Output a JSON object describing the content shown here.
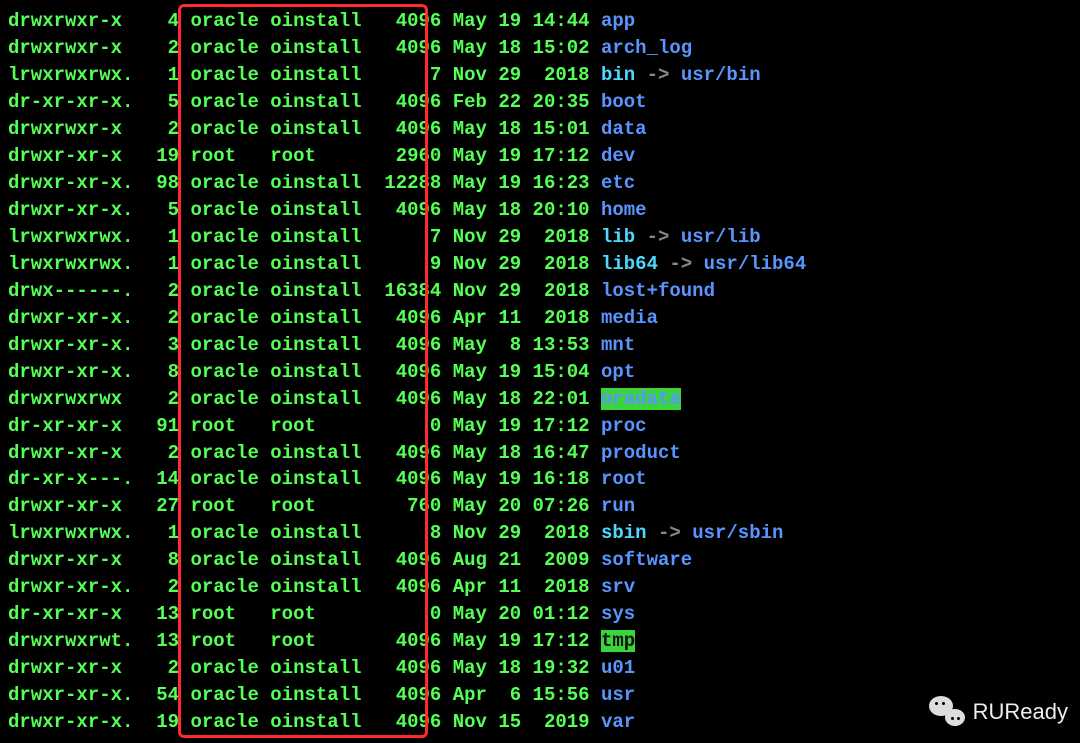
{
  "watermark": "RUReady",
  "entries": [
    {
      "perms": "drwxrwxr-x",
      "links": "4",
      "owner": "oracle",
      "group": "oinstall",
      "size": "4096",
      "date": "May 19 14:44",
      "name": "app",
      "type": "dir"
    },
    {
      "perms": "drwxrwxr-x",
      "links": "2",
      "owner": "oracle",
      "group": "oinstall",
      "size": "4096",
      "date": "May 18 15:02",
      "name": "arch_log",
      "type": "dir"
    },
    {
      "perms": "lrwxrwxrwx.",
      "links": "1",
      "owner": "oracle",
      "group": "oinstall",
      "size": "7",
      "date": "Nov 29  2018",
      "name": "bin",
      "type": "link",
      "target": "usr/bin"
    },
    {
      "perms": "dr-xr-xr-x.",
      "links": "5",
      "owner": "oracle",
      "group": "oinstall",
      "size": "4096",
      "date": "Feb 22 20:35",
      "name": "boot",
      "type": "dir"
    },
    {
      "perms": "drwxrwxr-x",
      "links": "2",
      "owner": "oracle",
      "group": "oinstall",
      "size": "4096",
      "date": "May 18 15:01",
      "name": "data",
      "type": "dir"
    },
    {
      "perms": "drwxr-xr-x",
      "links": "19",
      "owner": "root",
      "group": "root",
      "size": "2960",
      "date": "May 19 17:12",
      "name": "dev",
      "type": "dir"
    },
    {
      "perms": "drwxr-xr-x.",
      "links": "98",
      "owner": "oracle",
      "group": "oinstall",
      "size": "12288",
      "date": "May 19 16:23",
      "name": "etc",
      "type": "dir"
    },
    {
      "perms": "drwxr-xr-x.",
      "links": "5",
      "owner": "oracle",
      "group": "oinstall",
      "size": "4096",
      "date": "May 18 20:10",
      "name": "home",
      "type": "dir"
    },
    {
      "perms": "lrwxrwxrwx.",
      "links": "1",
      "owner": "oracle",
      "group": "oinstall",
      "size": "7",
      "date": "Nov 29  2018",
      "name": "lib",
      "type": "link",
      "target": "usr/lib"
    },
    {
      "perms": "lrwxrwxrwx.",
      "links": "1",
      "owner": "oracle",
      "group": "oinstall",
      "size": "9",
      "date": "Nov 29  2018",
      "name": "lib64",
      "type": "link",
      "target": "usr/lib64"
    },
    {
      "perms": "drwx------.",
      "links": "2",
      "owner": "oracle",
      "group": "oinstall",
      "size": "16384",
      "date": "Nov 29  2018",
      "name": "lost+found",
      "type": "dir"
    },
    {
      "perms": "drwxr-xr-x.",
      "links": "2",
      "owner": "oracle",
      "group": "oinstall",
      "size": "4096",
      "date": "Apr 11  2018",
      "name": "media",
      "type": "dir"
    },
    {
      "perms": "drwxr-xr-x.",
      "links": "3",
      "owner": "oracle",
      "group": "oinstall",
      "size": "4096",
      "date": "May  8 13:53",
      "name": "mnt",
      "type": "dir"
    },
    {
      "perms": "drwxr-xr-x.",
      "links": "8",
      "owner": "oracle",
      "group": "oinstall",
      "size": "4096",
      "date": "May 19 15:04",
      "name": "opt",
      "type": "dir"
    },
    {
      "perms": "drwxrwxrwx",
      "links": "2",
      "owner": "oracle",
      "group": "oinstall",
      "size": "4096",
      "date": "May 18 22:01",
      "name": "oradata",
      "type": "highlight"
    },
    {
      "perms": "dr-xr-xr-x",
      "links": "91",
      "owner": "root",
      "group": "root",
      "size": "0",
      "date": "May 19 17:12",
      "name": "proc",
      "type": "dir"
    },
    {
      "perms": "drwxr-xr-x",
      "links": "2",
      "owner": "oracle",
      "group": "oinstall",
      "size": "4096",
      "date": "May 18 16:47",
      "name": "product",
      "type": "dir"
    },
    {
      "perms": "dr-xr-x---.",
      "links": "14",
      "owner": "oracle",
      "group": "oinstall",
      "size": "4096",
      "date": "May 19 16:18",
      "name": "root",
      "type": "dir"
    },
    {
      "perms": "drwxr-xr-x",
      "links": "27",
      "owner": "root",
      "group": "root",
      "size": "760",
      "date": "May 20 07:26",
      "name": "run",
      "type": "dir"
    },
    {
      "perms": "lrwxrwxrwx.",
      "links": "1",
      "owner": "oracle",
      "group": "oinstall",
      "size": "8",
      "date": "Nov 29  2018",
      "name": "sbin",
      "type": "link",
      "target": "usr/sbin"
    },
    {
      "perms": "drwxr-xr-x",
      "links": "8",
      "owner": "oracle",
      "group": "oinstall",
      "size": "4096",
      "date": "Aug 21  2009",
      "name": "software",
      "type": "dir"
    },
    {
      "perms": "drwxr-xr-x.",
      "links": "2",
      "owner": "oracle",
      "group": "oinstall",
      "size": "4096",
      "date": "Apr 11  2018",
      "name": "srv",
      "type": "dir"
    },
    {
      "perms": "dr-xr-xr-x",
      "links": "13",
      "owner": "root",
      "group": "root",
      "size": "0",
      "date": "May 20 01:12",
      "name": "sys",
      "type": "dir"
    },
    {
      "perms": "drwxrwxrwt.",
      "links": "13",
      "owner": "root",
      "group": "root",
      "size": "4096",
      "date": "May 19 17:12",
      "name": "tmp",
      "type": "highlight-tmp"
    },
    {
      "perms": "drwxr-xr-x",
      "links": "2",
      "owner": "oracle",
      "group": "oinstall",
      "size": "4096",
      "date": "May 18 19:32",
      "name": "u01",
      "type": "dir"
    },
    {
      "perms": "drwxr-xr-x.",
      "links": "54",
      "owner": "oracle",
      "group": "oinstall",
      "size": "4096",
      "date": "Apr  6 15:56",
      "name": "usr",
      "type": "dir"
    },
    {
      "perms": "drwxr-xr-x.",
      "links": "19",
      "owner": "oracle",
      "group": "oinstall",
      "size": "4096",
      "date": "Nov 15  2019",
      "name": "var",
      "type": "dir"
    }
  ]
}
